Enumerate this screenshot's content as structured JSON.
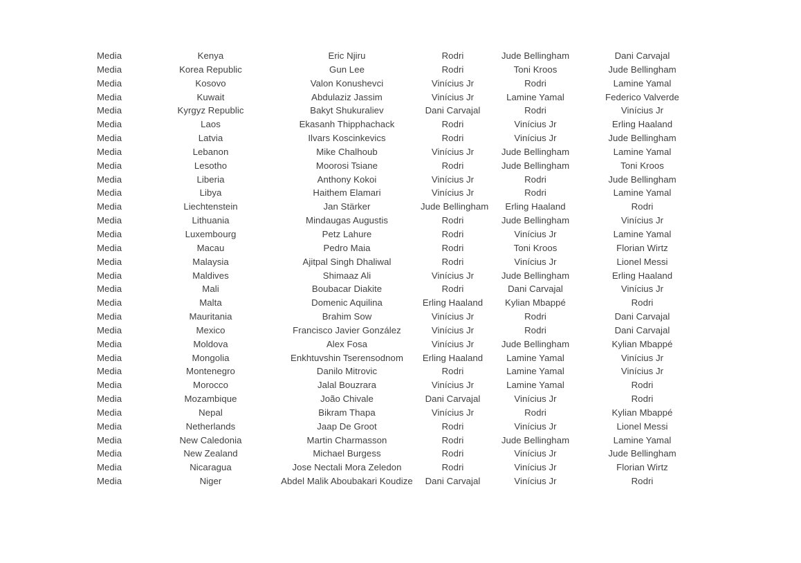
{
  "document": {
    "kind": "voting-results-table",
    "text_color": "#3f3f3f",
    "background_color": "#ffffff"
  },
  "table": {
    "columns": [
      {
        "key": "voter_type",
        "align": "left"
      },
      {
        "key": "country",
        "align": "center"
      },
      {
        "key": "voter_name",
        "align": "center"
      },
      {
        "key": "first_choice",
        "align": "center"
      },
      {
        "key": "second_choice",
        "align": "center"
      },
      {
        "key": "third_choice",
        "align": "center"
      }
    ],
    "rows": [
      {
        "voter_type": "Media",
        "country": "Kenya",
        "voter_name": "Eric Njiru",
        "first_choice": "Rodri",
        "second_choice": "Jude Bellingham",
        "third_choice": "Dani Carvajal"
      },
      {
        "voter_type": "Media",
        "country": "Korea Republic",
        "voter_name": "Gun Lee",
        "first_choice": "Rodri",
        "second_choice": "Toni Kroos",
        "third_choice": "Jude Bellingham"
      },
      {
        "voter_type": "Media",
        "country": "Kosovo",
        "voter_name": "Valon Konushevci",
        "first_choice": "Vinícius Jr",
        "second_choice": "Rodri",
        "third_choice": "Lamine Yamal"
      },
      {
        "voter_type": "Media",
        "country": "Kuwait",
        "voter_name": "Abdulaziz Jassim",
        "first_choice": "Vinícius Jr",
        "second_choice": "Lamine Yamal",
        "third_choice": "Federico Valverde"
      },
      {
        "voter_type": "Media",
        "country": "Kyrgyz Republic",
        "voter_name": "Bakyt Shukuraliev",
        "first_choice": "Dani Carvajal",
        "second_choice": "Rodri",
        "third_choice": "Vinícius Jr"
      },
      {
        "voter_type": "Media",
        "country": "Laos",
        "voter_name": "Ekasanh Thipphachack",
        "first_choice": "Rodri",
        "second_choice": "Vinícius Jr",
        "third_choice": "Erling Haaland"
      },
      {
        "voter_type": "Media",
        "country": "Latvia",
        "voter_name": "Ilvars Koscinkevics",
        "first_choice": "Rodri",
        "second_choice": "Vinícius Jr",
        "third_choice": "Jude Bellingham"
      },
      {
        "voter_type": "Media",
        "country": "Lebanon",
        "voter_name": "Mike Chalhoub",
        "first_choice": "Vinícius Jr",
        "second_choice": "Jude Bellingham",
        "third_choice": "Lamine Yamal"
      },
      {
        "voter_type": "Media",
        "country": "Lesotho",
        "voter_name": "Moorosi Tsiane",
        "first_choice": "Rodri",
        "second_choice": "Jude Bellingham",
        "third_choice": "Toni Kroos"
      },
      {
        "voter_type": "Media",
        "country": "Liberia",
        "voter_name": "Anthony Kokoi",
        "first_choice": "Vinícius Jr",
        "second_choice": "Rodri",
        "third_choice": "Jude Bellingham"
      },
      {
        "voter_type": "Media",
        "country": "Libya",
        "voter_name": "Haithem Elamari",
        "first_choice": "Vinícius Jr",
        "second_choice": "Rodri",
        "third_choice": "Lamine Yamal"
      },
      {
        "voter_type": "Media",
        "country": "Liechtenstein",
        "voter_name": "Jan Stärker",
        "first_choice": "Jude Bellingham",
        "second_choice": "Erling Haaland",
        "third_choice": "Rodri"
      },
      {
        "voter_type": "Media",
        "country": "Lithuania",
        "voter_name": "Mindaugas Augustis",
        "first_choice": "Rodri",
        "second_choice": "Jude Bellingham",
        "third_choice": "Vinícius Jr"
      },
      {
        "voter_type": "Media",
        "country": "Luxembourg",
        "voter_name": "Petz Lahure",
        "first_choice": "Rodri",
        "second_choice": "Vinícius Jr",
        "third_choice": "Lamine Yamal"
      },
      {
        "voter_type": "Media",
        "country": "Macau",
        "voter_name": "Pedro Maia",
        "first_choice": "Rodri",
        "second_choice": "Toni Kroos",
        "third_choice": "Florian Wirtz"
      },
      {
        "voter_type": "Media",
        "country": "Malaysia",
        "voter_name": "Ajitpal Singh Dhaliwal",
        "first_choice": "Rodri",
        "second_choice": "Vinícius Jr",
        "third_choice": "Lionel Messi"
      },
      {
        "voter_type": "Media",
        "country": "Maldives",
        "voter_name": "Shimaaz Ali",
        "first_choice": "Vinícius Jr",
        "second_choice": "Jude Bellingham",
        "third_choice": "Erling Haaland"
      },
      {
        "voter_type": "Media",
        "country": "Mali",
        "voter_name": "Boubacar Diakite",
        "first_choice": "Rodri",
        "second_choice": "Dani Carvajal",
        "third_choice": "Vinícius Jr"
      },
      {
        "voter_type": "Media",
        "country": "Malta",
        "voter_name": "Domenic Aquilina",
        "first_choice": "Erling Haaland",
        "second_choice": "Kylian Mbappé",
        "third_choice": "Rodri"
      },
      {
        "voter_type": "Media",
        "country": "Mauritania",
        "voter_name": "Brahim Sow",
        "first_choice": "Vinícius Jr",
        "second_choice": "Rodri",
        "third_choice": "Dani Carvajal"
      },
      {
        "voter_type": "Media",
        "country": "Mexico",
        "voter_name": "Francisco Javier González",
        "first_choice": "Vinícius Jr",
        "second_choice": "Rodri",
        "third_choice": "Dani Carvajal"
      },
      {
        "voter_type": "Media",
        "country": "Moldova",
        "voter_name": "Alex Fosa",
        "first_choice": "Vinícius Jr",
        "second_choice": "Jude Bellingham",
        "third_choice": "Kylian Mbappé"
      },
      {
        "voter_type": "Media",
        "country": "Mongolia",
        "voter_name": "Enkhtuvshin Tserensodnom",
        "first_choice": "Erling Haaland",
        "second_choice": "Lamine Yamal",
        "third_choice": "Vinícius Jr"
      },
      {
        "voter_type": "Media",
        "country": "Montenegro",
        "voter_name": "Danilo Mitrovic",
        "first_choice": "Rodri",
        "second_choice": "Lamine Yamal",
        "third_choice": "Vinícius Jr"
      },
      {
        "voter_type": "Media",
        "country": "Morocco",
        "voter_name": "Jalal Bouzrara",
        "first_choice": "Vinícius Jr",
        "second_choice": "Lamine Yamal",
        "third_choice": "Rodri"
      },
      {
        "voter_type": "Media",
        "country": "Mozambique",
        "voter_name": "João Chivale",
        "first_choice": "Dani Carvajal",
        "second_choice": "Vinícius Jr",
        "third_choice": "Rodri"
      },
      {
        "voter_type": "Media",
        "country": "Nepal",
        "voter_name": "Bikram Thapa",
        "first_choice": "Vinícius Jr",
        "second_choice": "Rodri",
        "third_choice": "Kylian Mbappé"
      },
      {
        "voter_type": "Media",
        "country": "Netherlands",
        "voter_name": "Jaap De Groot",
        "first_choice": "Rodri",
        "second_choice": "Vinícius Jr",
        "third_choice": "Lionel Messi"
      },
      {
        "voter_type": "Media",
        "country": "New Caledonia",
        "voter_name": "Martin Charmasson",
        "first_choice": "Rodri",
        "second_choice": "Jude Bellingham",
        "third_choice": "Lamine Yamal"
      },
      {
        "voter_type": "Media",
        "country": "New Zealand",
        "voter_name": "Michael Burgess",
        "first_choice": "Rodri",
        "second_choice": "Vinícius Jr",
        "third_choice": "Jude Bellingham"
      },
      {
        "voter_type": "Media",
        "country": "Nicaragua",
        "voter_name": "Jose Nectali Mora Zeledon",
        "first_choice": "Rodri",
        "second_choice": "Vinícius Jr",
        "third_choice": "Florian Wirtz"
      },
      {
        "voter_type": "Media",
        "country": "Niger",
        "voter_name": "Abdel Malik Aboubakari Koudize",
        "first_choice": "Dani Carvajal",
        "second_choice": "Vinícius Jr",
        "third_choice": "Rodri"
      }
    ]
  }
}
